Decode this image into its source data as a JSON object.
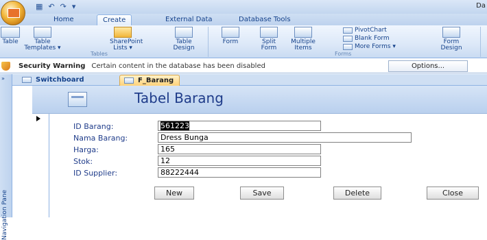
{
  "title_bar": {
    "right_text": "Da"
  },
  "quick_access": {
    "save_icon": "save-icon",
    "undo_icon": "undo-icon",
    "redo_icon": "redo-icon"
  },
  "ribbon_tabs": [
    "Home",
    "Create",
    "External Data",
    "Database Tools"
  ],
  "active_ribbon_tab": "Create",
  "ribbon": {
    "tables_group": {
      "label": "Tables",
      "buttons": [
        "Table",
        "Table Templates ▾",
        "SharePoint Lists ▾",
        "Table Design"
      ]
    },
    "forms_group": {
      "label": "Forms",
      "buttons": [
        "Form",
        "Split Form",
        "Multiple Items",
        "Form Design"
      ],
      "small_buttons": [
        "PivotChart",
        "Blank Form",
        "More Forms ▾"
      ]
    }
  },
  "security_bar": {
    "title": "Security Warning",
    "message": "Certain content in the database has been disabled",
    "options_label": "Options..."
  },
  "nav_pane": {
    "toggle": "»",
    "label": "Navigation Pane"
  },
  "doc_tabs": [
    "Switchboard",
    "F_Barang"
  ],
  "active_doc_tab": "F_Barang",
  "form": {
    "title": "Tabel Barang",
    "fields": [
      {
        "label": "ID Barang:",
        "value": "561223"
      },
      {
        "label": "Nama Barang:",
        "value": "Dress Bunga"
      },
      {
        "label": "Harga:",
        "value": "165"
      },
      {
        "label": "Stok:",
        "value": "12"
      },
      {
        "label": "ID Supplier:",
        "value": "88222444"
      }
    ],
    "buttons": [
      "New",
      "Save",
      "Delete",
      "Close"
    ]
  }
}
